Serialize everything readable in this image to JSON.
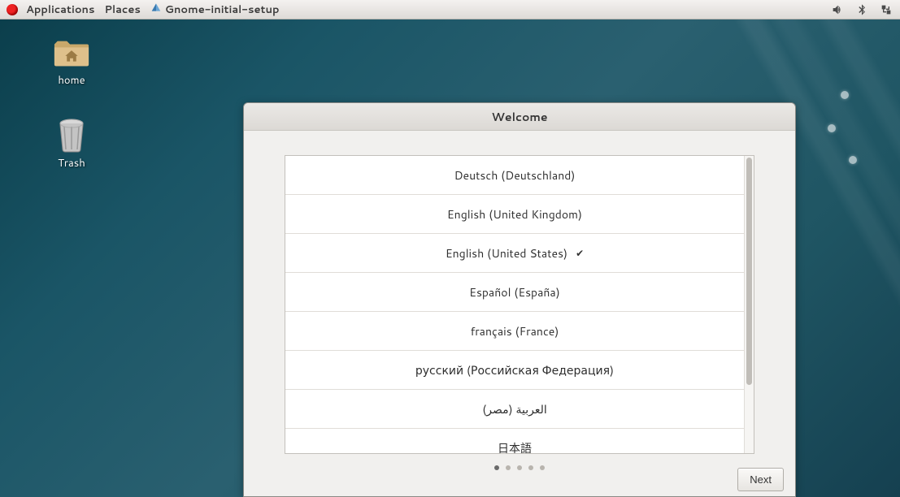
{
  "top_panel": {
    "applications": "Applications",
    "places": "Places",
    "current_app": "Gnome-initial-setup"
  },
  "desktop": {
    "home_label": "home",
    "trash_label": "Trash"
  },
  "setup": {
    "title": "Welcome",
    "languages": [
      {
        "label": "Deutsch (Deutschland)",
        "selected": false
      },
      {
        "label": "English (United Kingdom)",
        "selected": false
      },
      {
        "label": "English (United States)",
        "selected": true
      },
      {
        "label": "Español (España)",
        "selected": false
      },
      {
        "label": "français (France)",
        "selected": false
      },
      {
        "label": "русский (Российская Федерация)",
        "selected": false
      },
      {
        "label": "العربية (مصر)",
        "selected": false
      },
      {
        "label": "日本語",
        "selected": false
      }
    ],
    "page_count": 5,
    "page_active": 0,
    "next_label": "Next"
  }
}
